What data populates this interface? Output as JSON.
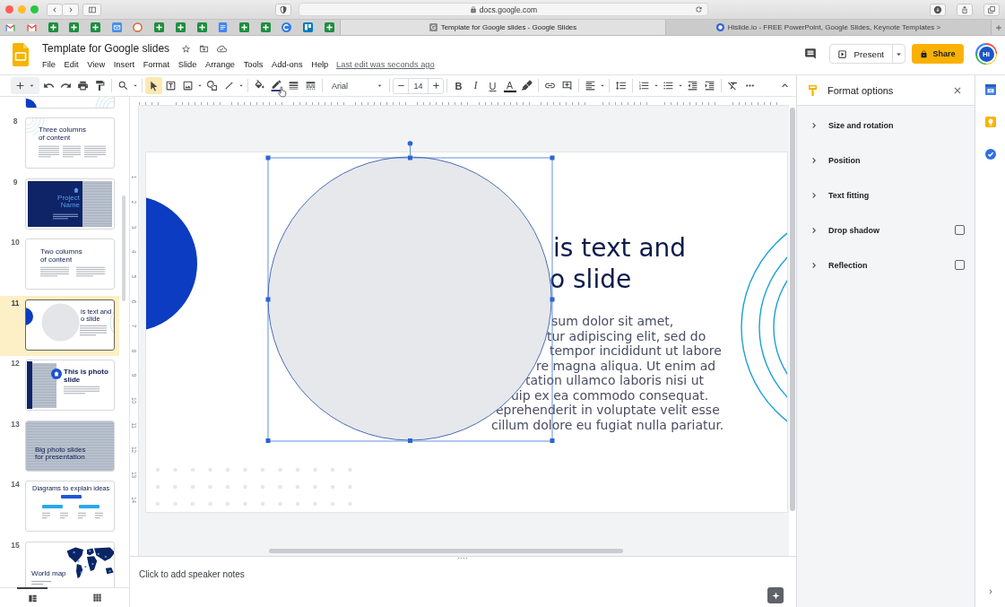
{
  "browser": {
    "url": "docs.google.com",
    "tabs": [
      {
        "label": "Template for Google slides - Google Slides",
        "selected": true
      },
      {
        "label": "Hislide.io - FREE PowerPoint, Google Slides, Keynote Templates >",
        "selected": false
      }
    ]
  },
  "document": {
    "title": "Template for Google slides",
    "menu": [
      "File",
      "Edit",
      "View",
      "Insert",
      "Format",
      "Slide",
      "Arrange",
      "Tools",
      "Add-ons",
      "Help"
    ],
    "last_edit": "Last edit was seconds ago",
    "present_label": "Present",
    "share_label": "Share",
    "account_initials": "Hi"
  },
  "toolbar": {
    "tools": [
      {
        "kind": "select",
        "selected": true
      },
      {
        "kind": "textbox",
        "selected": false
      },
      {
        "kind": "image",
        "selected": false
      },
      {
        "kind": "shape",
        "selected": false
      },
      {
        "kind": "line",
        "selected": false
      }
    ],
    "font": "Arial",
    "font_size": "14",
    "style_buttons": [
      {
        "kind": "bold",
        "label": "B"
      },
      {
        "kind": "italic",
        "label": "I"
      },
      {
        "kind": "underline",
        "label": "U"
      }
    ],
    "text_color_label": "A"
  },
  "slides": [
    {
      "kind": "partial",
      "selected": false
    },
    {
      "number": "8",
      "kind": "columns3",
      "title_lines": [
        "Three columns",
        "of content"
      ],
      "selected": false
    },
    {
      "number": "9",
      "kind": "project",
      "title_lines": [
        "Project",
        "Name"
      ],
      "selected": false
    },
    {
      "number": "10",
      "kind": "columns2",
      "title_lines": [
        "Two columns",
        "of content"
      ],
      "selected": false
    },
    {
      "number": "11",
      "kind": "textphoto",
      "title_lines": [
        "is text and",
        "o slide"
      ],
      "selected": true
    },
    {
      "number": "12",
      "kind": "photo",
      "title_lines": [
        "This is photo",
        "slide"
      ],
      "selected": false
    },
    {
      "number": "13",
      "kind": "bigphoto",
      "title_lines": [
        "Big photo slides",
        "for presentation"
      ],
      "selected": false
    },
    {
      "number": "14",
      "kind": "diagram",
      "title_lines": [
        "Diagrams to explain ideas"
      ],
      "selected": false
    },
    {
      "number": "15",
      "kind": "map",
      "title_lines": [
        "World map"
      ],
      "selected": false
    }
  ],
  "ruler_marks": [
    "1",
    "2",
    "3",
    "4",
    "5",
    "6",
    "7",
    "8",
    "9",
    "10",
    "11",
    "12",
    "13",
    "14"
  ],
  "slide": {
    "title_lines": [
      "is text and",
      "o slide"
    ],
    "body_lines": [
      "sum dolor sit amet,",
      "tur adipiscing elit, sed do",
      "tempor incididunt ut labore",
      "re magna aliqua. Ut enim ad",
      "tation ullamco laboris nisi ut",
      "uip ex ea commodo consequat.",
      "eprehenderit in voluptate velit esse",
      "cillum dolore eu fugiat nulla pariatur."
    ]
  },
  "speaker_notes": {
    "placeholder": "Click to add speaker notes"
  },
  "format_options": {
    "title": "Format options",
    "sections": [
      {
        "kind": "plain",
        "label": "Size and rotation",
        "expanded": false
      },
      {
        "kind": "plain",
        "label": "Position",
        "expanded": false
      },
      {
        "kind": "plain",
        "label": "Text fitting",
        "expanded": false
      },
      {
        "kind": "checkbox",
        "label": "Drop shadow",
        "expanded": false,
        "checked": false
      },
      {
        "kind": "checkbox",
        "label": "Reflection",
        "expanded": false,
        "checked": false
      }
    ]
  }
}
